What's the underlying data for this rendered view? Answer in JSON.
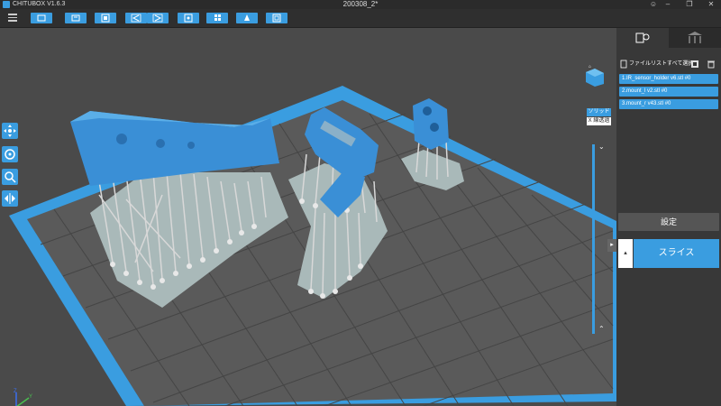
{
  "titlebar": {
    "app_name": "CHITUBOX V1.6.3",
    "document_title": "200308_2*",
    "user_icon": "user-icon",
    "minimize_icon": "minimize-icon",
    "maximize_icon": "maximize-icon",
    "close_icon": "close-icon"
  },
  "toolbar": {
    "buttons": [
      "open-file-icon",
      "save-icon",
      "hollow-icon",
      "undo-icon",
      "redo-icon",
      "print-settings-icon",
      "arrange-icon",
      "drill-hole-icon",
      "slice-settings-icon"
    ]
  },
  "viewport": {
    "display_mode": {
      "solid": "ソリッド",
      "xray": "X 線透過"
    },
    "left_tools": [
      "move-icon",
      "rotate-icon",
      "scale-icon",
      "mirror-icon"
    ],
    "axis": {
      "x": "X",
      "y": "Y",
      "z": "Z"
    }
  },
  "panel": {
    "tabs": [
      "settings-tab-icon",
      "supports-tab-icon"
    ],
    "select_all_label": "ファイルリストすべて選択",
    "files": [
      "1.IR_sensor_holder v6.stl #0",
      "2.mount_l v2.stl #0",
      "3.mount_r v43.stl #0"
    ],
    "settings_label": "設定",
    "slice_label": "スライス"
  },
  "colors": {
    "accent": "#3a9de0",
    "background": "#4a4a4a",
    "panel": "#383838"
  }
}
